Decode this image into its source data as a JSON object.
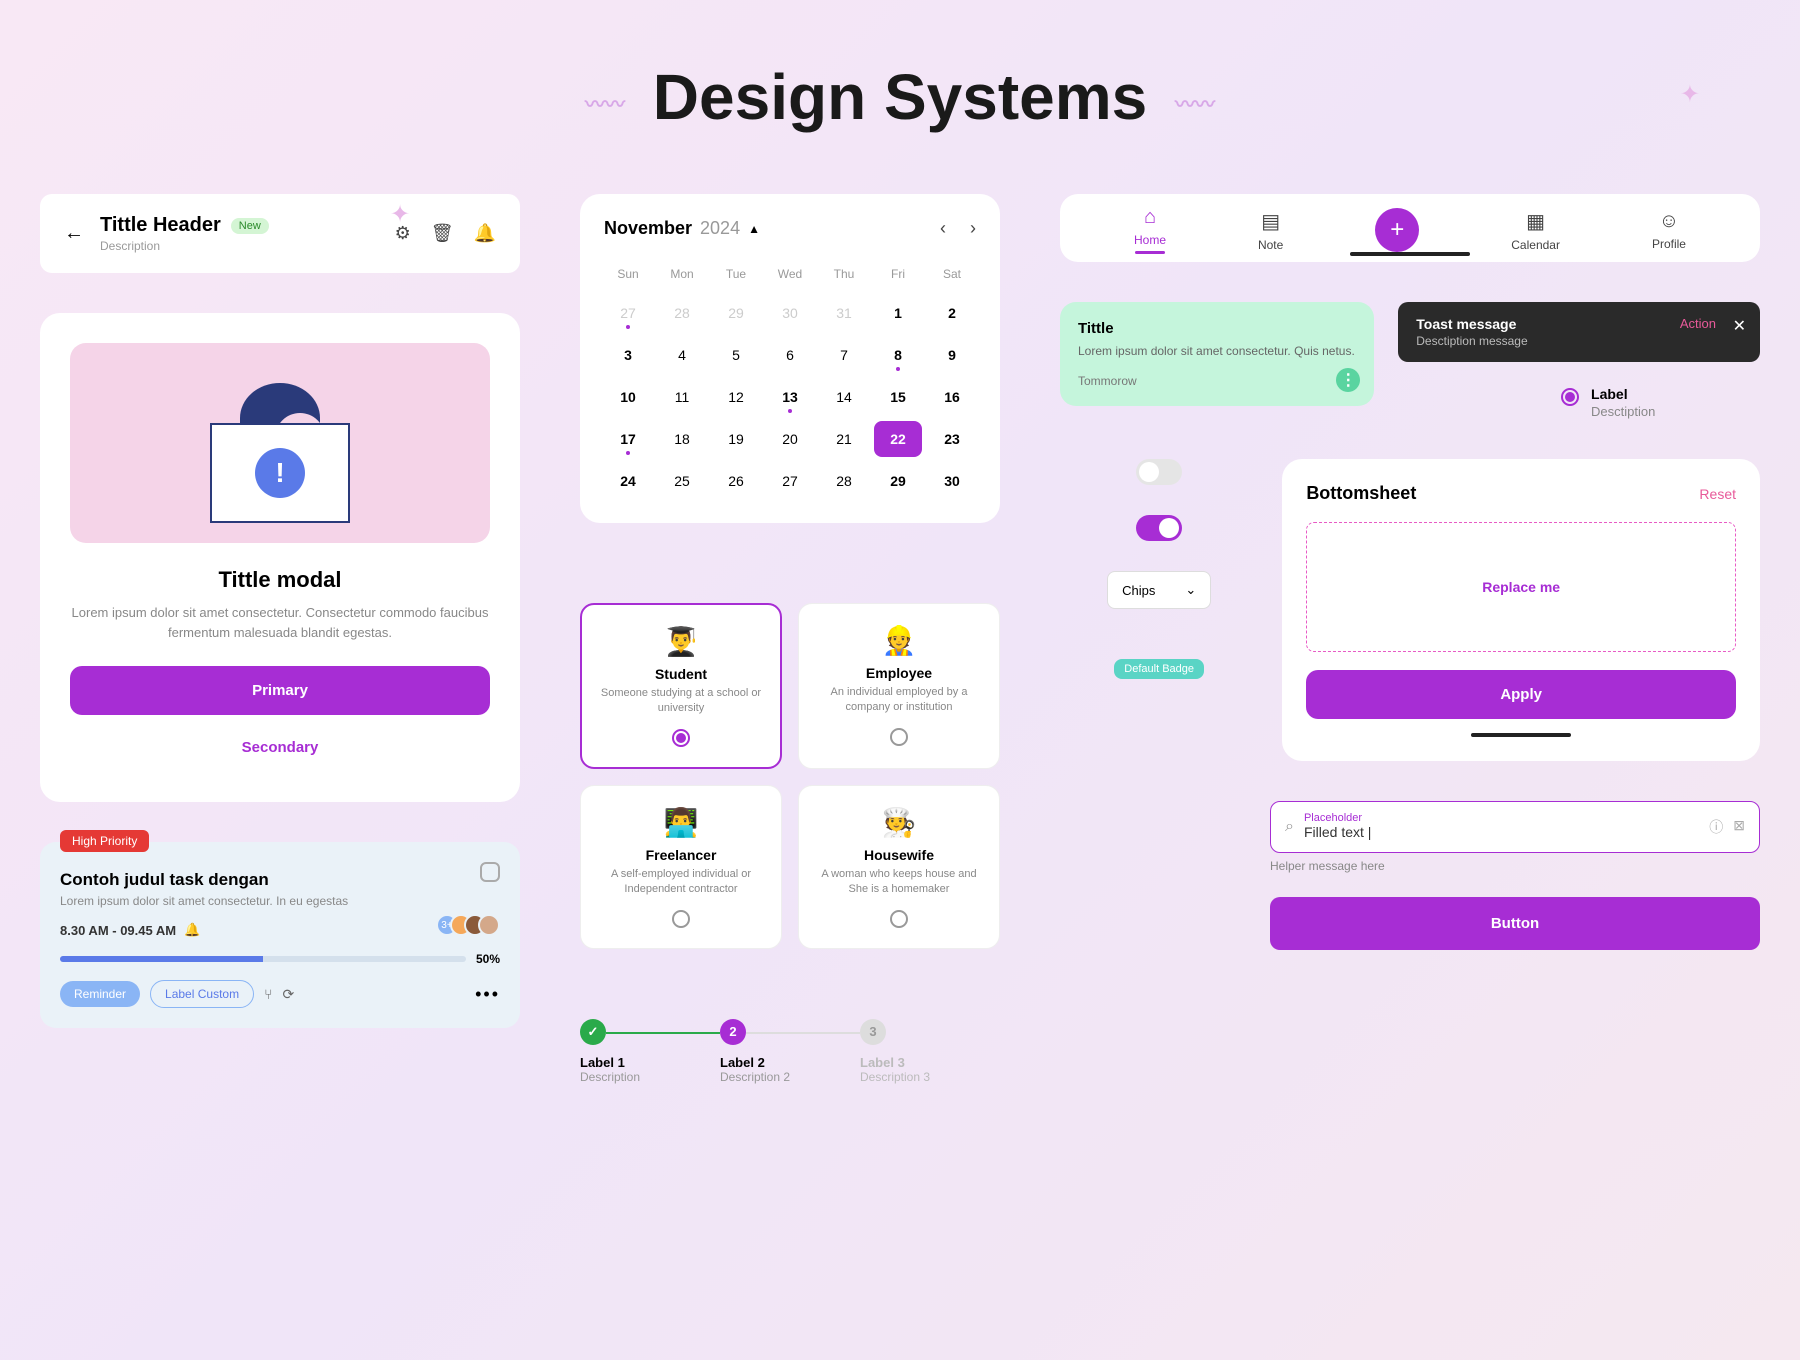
{
  "page": {
    "title": "Design Systems"
  },
  "header": {
    "title": "Tittle Header",
    "badge": "New",
    "subtitle": "Description"
  },
  "modal": {
    "title": "Tittle modal",
    "body": "Lorem ipsum dolor sit amet consectetur. Consectetur commodo faucibus fermentum malesuada blandit egestas.",
    "primary": "Primary",
    "secondary": "Secondary"
  },
  "task": {
    "priority": "High Priority",
    "title": "Contoh judul task dengan",
    "desc": "Lorem ipsum dolor sit amet consectetur. In eu egestas",
    "time": "8.30 AM - 09.45 AM",
    "avatar_more": "3+",
    "progress_pct": "50%",
    "chip_reminder": "Reminder",
    "chip_custom": "Label Custom"
  },
  "calendar": {
    "month": "November",
    "year": "2024",
    "dow": [
      "Sun",
      "Mon",
      "Tue",
      "Wed",
      "Thu",
      "Fri",
      "Sat"
    ],
    "days": [
      {
        "n": "27",
        "muted": true,
        "dot": true
      },
      {
        "n": "28",
        "muted": true
      },
      {
        "n": "29",
        "muted": true
      },
      {
        "n": "30",
        "muted": true
      },
      {
        "n": "31",
        "muted": true
      },
      {
        "n": "1",
        "bold": true
      },
      {
        "n": "2",
        "bold": true
      },
      {
        "n": "3",
        "bold": true
      },
      {
        "n": "4"
      },
      {
        "n": "5"
      },
      {
        "n": "6"
      },
      {
        "n": "7"
      },
      {
        "n": "8",
        "bold": true,
        "dot": true
      },
      {
        "n": "9",
        "bold": true
      },
      {
        "n": "10",
        "bold": true
      },
      {
        "n": "11"
      },
      {
        "n": "12"
      },
      {
        "n": "13",
        "bold": true,
        "dot": true
      },
      {
        "n": "14"
      },
      {
        "n": "15",
        "bold": true
      },
      {
        "n": "16",
        "bold": true
      },
      {
        "n": "17",
        "bold": true,
        "dot": true
      },
      {
        "n": "18"
      },
      {
        "n": "19"
      },
      {
        "n": "20"
      },
      {
        "n": "21"
      },
      {
        "n": "22",
        "selected": true
      },
      {
        "n": "23",
        "bold": true
      },
      {
        "n": "24",
        "bold": true
      },
      {
        "n": "25"
      },
      {
        "n": "26"
      },
      {
        "n": "27"
      },
      {
        "n": "28"
      },
      {
        "n": "29",
        "bold": true
      },
      {
        "n": "30",
        "bold": true
      }
    ]
  },
  "options": [
    {
      "emoji": "👨‍🎓",
      "title": "Student",
      "desc": "Someone studying at a school or university",
      "selected": true
    },
    {
      "emoji": "👷",
      "title": "Employee",
      "desc": "An individual employed by a company or institution"
    },
    {
      "emoji": "👨‍💻",
      "title": "Freelancer",
      "desc": "A self-employed individual or Independent contractor"
    },
    {
      "emoji": "🧑‍🍳",
      "title": "Housewife",
      "desc": "A woman who keeps house and She is a homemaker"
    }
  ],
  "stepper": [
    {
      "label": "Label 1",
      "desc": "Description",
      "icon": "✓"
    },
    {
      "label": "Label 2",
      "desc": "Description 2",
      "icon": "2"
    },
    {
      "label": "Label 3",
      "desc": "Description 3",
      "icon": "3"
    }
  ],
  "tabs": {
    "home": "Home",
    "note": "Note",
    "calendar": "Calendar",
    "profile": "Profile"
  },
  "note": {
    "title": "Tittle",
    "body": "Lorem ipsum dolor sit amet consectetur. Quis netus.",
    "date": "Tommorow"
  },
  "toast": {
    "title": "Toast message",
    "body": "Desctiption message",
    "action": "Action"
  },
  "radio_label": {
    "label": "Label",
    "desc": "Desctiption"
  },
  "chips_dropdown": "Chips",
  "default_badge": "Default Badge",
  "bottomsheet": {
    "title": "Bottomsheet",
    "reset": "Reset",
    "placeholder": "Replace me",
    "apply": "Apply"
  },
  "input": {
    "placeholder": "Placeholder",
    "value": "Filled text |",
    "helper": "Helper message here"
  },
  "main_button": "Button"
}
